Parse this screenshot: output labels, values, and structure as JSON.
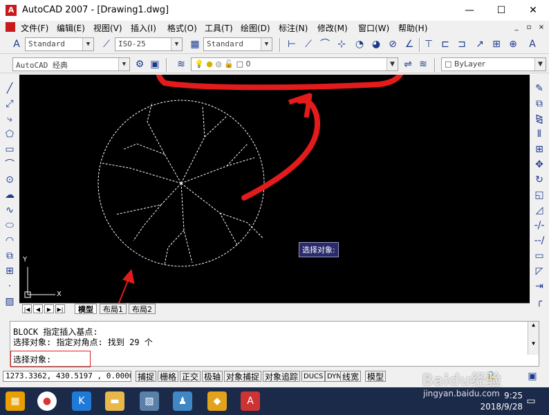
{
  "window": {
    "title": "AutoCAD 2007 - [Drawing1.dwg]",
    "minimize": "—",
    "maximize": "☐",
    "close": "✕"
  },
  "menu": {
    "items": [
      "文件(F)",
      "编辑(E)",
      "视图(V)",
      "插入(I)",
      "格式(O)",
      "工具(T)",
      "绘图(D)",
      "标注(N)",
      "修改(M)",
      "窗口(W)",
      "帮助(H)"
    ],
    "mdi": [
      "_",
      "▫",
      "×"
    ]
  },
  "toolbar1": {
    "text_style": "Standard",
    "dim_style": "ISO-25",
    "table_style": "Standard"
  },
  "toolbar2": {
    "workspace": "AutoCAD 经典",
    "layer_value": "0",
    "color": "ByLayer"
  },
  "canvas": {
    "background": "#000000",
    "tooltip": "选择对象:",
    "ucs_x": "X",
    "ucs_y": "Y"
  },
  "tabs": {
    "nav": [
      "|◀",
      "◀",
      "▶",
      "▶|"
    ],
    "items": [
      "模型",
      "布局1",
      "布局2"
    ]
  },
  "command": {
    "lines": [
      "BLOCK 指定插入基点:",
      "选择对象: 指定对角点: 找到 29 个",
      "选择对象:"
    ]
  },
  "status": {
    "coords": "1273.3362, 430.5197 , 0.0000",
    "buttons": [
      "捕捉",
      "栅格",
      "正交",
      "极轴",
      "对象捕捉",
      "对象追踪",
      "DUCS",
      "DYN",
      "线宽",
      "模型"
    ]
  },
  "taskbar": {
    "time": "9:25",
    "date": "2018/9/28"
  },
  "watermark": {
    "brand": "Baidu经验",
    "url": "jingyan.baidu.com"
  },
  "colors": {
    "annotation": "#e31b1b",
    "tooltip_bg": "#2b2b6b"
  }
}
